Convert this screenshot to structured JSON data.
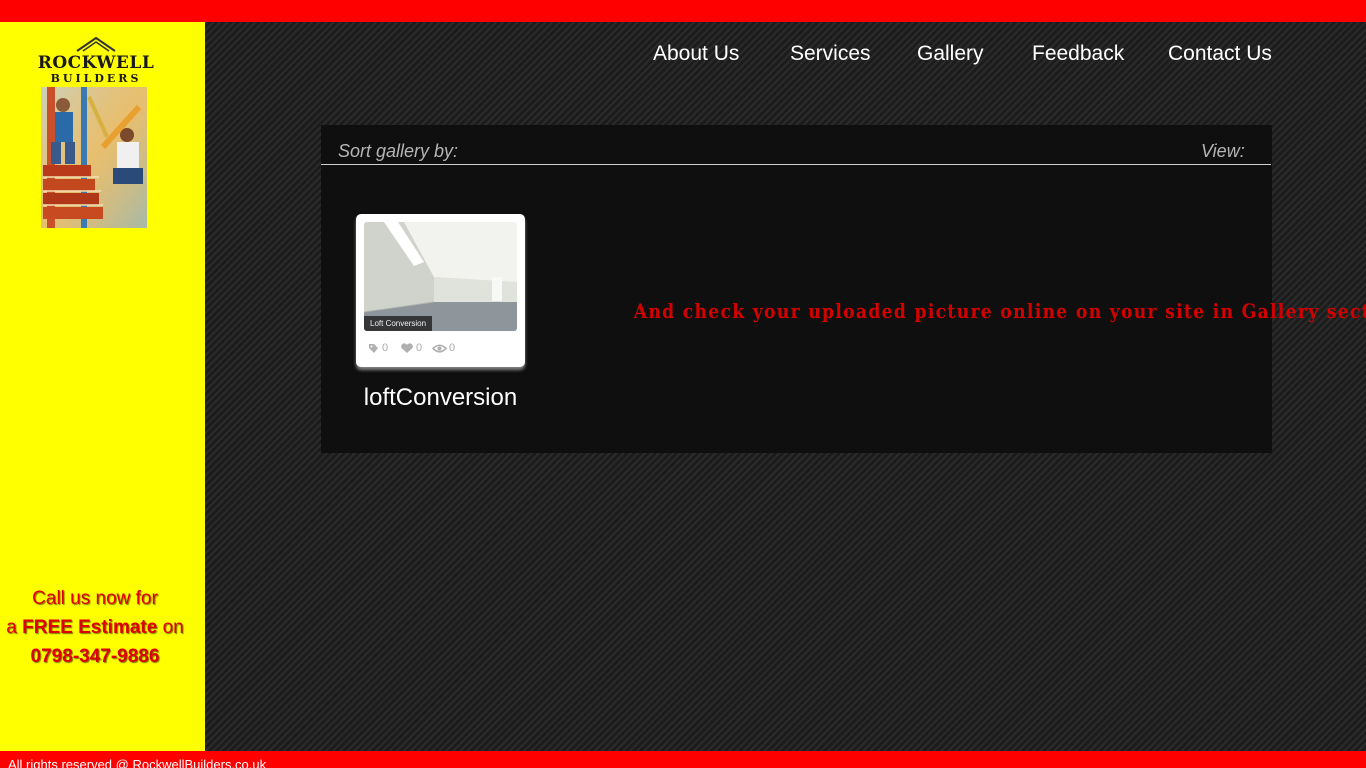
{
  "site": {
    "brand_line1": "ROCKWELL",
    "brand_line2": "BUILDERS"
  },
  "nav": {
    "items": [
      {
        "label": "About Us"
      },
      {
        "label": "Services"
      },
      {
        "label": "Gallery"
      },
      {
        "label": "Feedback"
      },
      {
        "label": "Contact Us"
      }
    ]
  },
  "sidebar": {
    "cta_line1": "Call us now for",
    "cta_line2_pre": "a ",
    "cta_line2_bold": "FREE Estimate",
    "cta_line2_post": " on",
    "cta_phone": "0798-347-9886"
  },
  "gallery": {
    "sort_label": "Sort gallery by:",
    "view_label": "View:",
    "items": [
      {
        "title": "loftConversion",
        "image_caption": "Loft Conversion",
        "tags": "0",
        "likes": "0",
        "views": "0"
      }
    ],
    "promo_text": "And check your uploaded picture online on your site in Gallery section."
  },
  "footer": {
    "text": "All rights reserved @ RockwellBuilders.co.uk"
  },
  "colors": {
    "bar_red": "#ff0000",
    "sidebar_yellow": "#ffff00",
    "cta_red": "#e00000",
    "promo_red": "#d40000",
    "panel_dark": "#0f0f0f"
  }
}
